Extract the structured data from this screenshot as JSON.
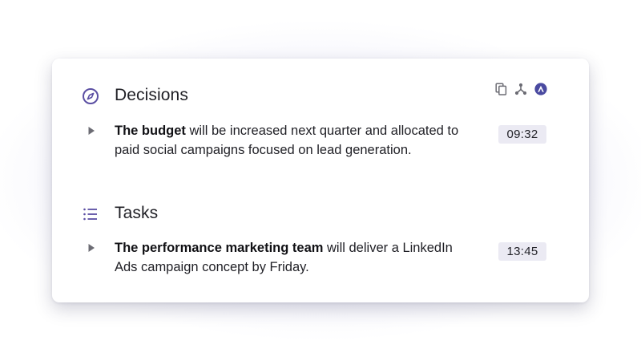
{
  "toolbar": {
    "icons": [
      "copy-icon",
      "share-icon",
      "brand-logo-icon"
    ]
  },
  "sections": [
    {
      "title": "Decisions",
      "icon": "compass-icon",
      "items": [
        {
          "subject": "The budget",
          "text": " will be increased next quarter and allocated to paid social campaigns focused on lead generation.",
          "time": "09:32"
        }
      ]
    },
    {
      "title": "Tasks",
      "icon": "list-icon",
      "items": [
        {
          "subject": "The performance marketing team",
          "text": " will deliver a LinkedIn Ads campaign concept by Friday.",
          "time": "13:45"
        }
      ]
    }
  ],
  "colors": {
    "accent": "#5b4fa3",
    "icon_gray": "#6c6c74",
    "badge_bg": "#ebeaf3"
  }
}
